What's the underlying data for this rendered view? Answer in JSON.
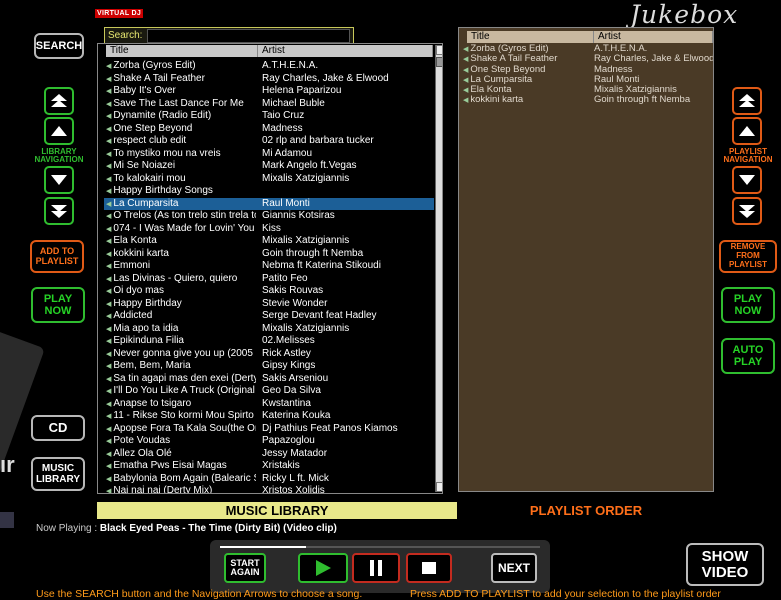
{
  "brand": "VIRTUAL DJ",
  "title": "Jukebox",
  "left_buttons": {
    "search": "SEARCH",
    "library_nav": "LIBRARY\nNAVIGATION",
    "add_to_playlist": "ADD TO\nPLAYLIST",
    "play_now": "PLAY\nNOW",
    "cd": "CD",
    "music_library": "MUSIC\nLIBRARY"
  },
  "right_buttons": {
    "playlist_nav": "PLAYLIST\nNAVIGATION",
    "remove_from_playlist": "REMOVE FROM\nPLAYLIST",
    "play_now": "PLAY\nNOW",
    "auto_play": "AUTO\nPLAY"
  },
  "search": {
    "label": "Search:",
    "value": ""
  },
  "library": {
    "columns": [
      "Title",
      "Artist"
    ],
    "footer": "MUSIC LIBRARY",
    "selected_index": 11,
    "rows": [
      [
        "Zorba (Gyros Edit)",
        "A.T.H.E.N.A."
      ],
      [
        "Shake A Tail Feather",
        "Ray Charles, Jake & Elwood"
      ],
      [
        "Baby It's Over",
        "Helena Paparizou"
      ],
      [
        "Save The Last Dance For Me",
        "Michael Buble"
      ],
      [
        "Dynamite (Radio Edit)",
        "Taio Cruz"
      ],
      [
        "One Step Beyond",
        "Madness"
      ],
      [
        "respect club edit",
        "02 rlp and barbara tucker"
      ],
      [
        "To mystiko mou na vreis",
        "Mi Adamou"
      ],
      [
        "Mi Se Noiazei",
        "Mark Angelo ft.Vegas"
      ],
      [
        "To kalokairi mou",
        "Mixalis Xatzigiannis"
      ],
      [
        "Happy Birthday Songs",
        ""
      ],
      [
        "La Cumparsita",
        "Raul Monti"
      ],
      [
        "O Trelos (As ton trelo stin trela tou)",
        "Giannis Kotsiras"
      ],
      [
        "074 - I Was Made for Lovin' You",
        "Kiss"
      ],
      [
        "Ela Konta",
        "Mixalis Xatzigiannis"
      ],
      [
        "kokkini karta",
        "Goin through ft Nemba"
      ],
      [
        "Emmoni",
        "Nebma ft Katerina Stikoudi"
      ],
      [
        "Las Divinas - Quiero, quiero",
        "Patito Feo"
      ],
      [
        "Oi dyo mas",
        "Sakis Rouvas"
      ],
      [
        "Happy Birthday",
        "Stevie Wonder"
      ],
      [
        "Addicted",
        "Serge Devant feat Hadley"
      ],
      [
        "Mia apo ta idia",
        "Mixalis Xatzigiannis"
      ],
      [
        "Epikinduna Filia",
        "02.Melisses"
      ],
      [
        "Never gonna give you up (2005 H...",
        "Rick Astley"
      ],
      [
        "Bem, Bem, Maria",
        "Gipsy Kings"
      ],
      [
        "Sa tin agapi mas den exei (Derty ...",
        "Sakis Arseniou"
      ],
      [
        "I'll Do You Like A Truck (Original Mix)",
        "Geo Da Silva"
      ],
      [
        "Anapse to tsigaro",
        "Kwstantina"
      ],
      [
        "11 - Rikse Sto kormi Mou Spirto",
        "Katerina Kouka"
      ],
      [
        "Apopse Fora Ta Kala Sou(the Ori...",
        "Dj Pathius Feat Panos Kiamos"
      ],
      [
        "Pote Voudas",
        "Papazoglou"
      ],
      [
        "Allez Ola Olé",
        "Jessy Matador"
      ],
      [
        "Ematha Pws Eisai Magas",
        "Xristakis"
      ],
      [
        "Babylonia Bom Again (Balearic S...",
        "Ricky L ft. Mick"
      ],
      [
        "Nai nai nai  (Derty Mix)",
        "Xristos Xolidis"
      ]
    ]
  },
  "playlist": {
    "columns": [
      "Title",
      "Artist"
    ],
    "footer": "PLAYLIST ORDER",
    "rows": [
      [
        "Zorba (Gyros Edit)",
        "A.T.H.E.N.A."
      ],
      [
        "Shake A Tail Feather",
        "Ray Charles, Jake & Elwood"
      ],
      [
        "One Step Beyond",
        "Madness"
      ],
      [
        "La Cumparsita",
        "Raul Monti"
      ],
      [
        "Ela Konta",
        "Mixalis Xatzigiannis"
      ],
      [
        "kokkini karta",
        "Goin through ft Nemba"
      ]
    ]
  },
  "now_playing": {
    "label": "Now Playing :",
    "track": "Black Eyed Peas - The Time (Dirty Bit) (Video clip)"
  },
  "transport": {
    "start_again": "START\nAGAIN",
    "next": "NEXT",
    "progress": 0.27
  },
  "show_video": "SHOW\nVIDEO",
  "hints": {
    "left": "Use the  SEARCH button and the Navigation Arrows to choose a song.",
    "right": "Press ADD TO PLAYLIST to add your selection to the playlist order"
  },
  "deco": {
    "letter": "ır"
  },
  "colors": {
    "accent_green": "#2fbd2f",
    "accent_orange": "#ff6f1a",
    "selection": "#1c5f97",
    "library_footer": "#e8e88a",
    "playlist_bg": "#4a3a26"
  }
}
